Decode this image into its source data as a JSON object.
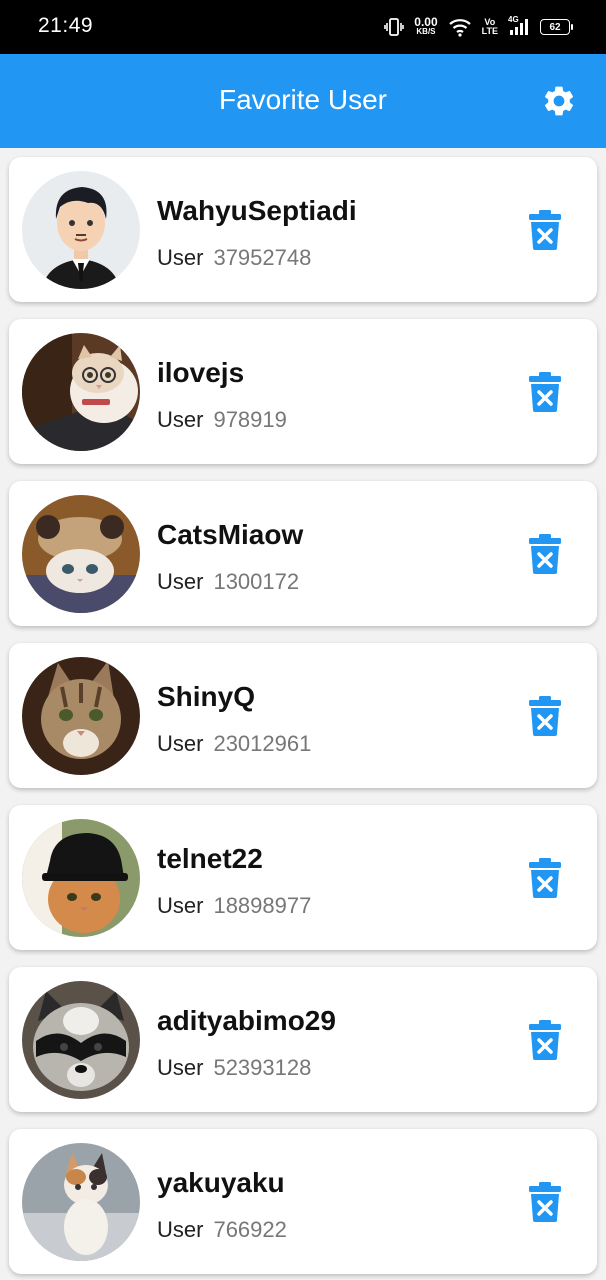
{
  "status_bar": {
    "time": "21:49",
    "net_speed_value": "0.00",
    "net_speed_unit": "KB/S",
    "volte_top": "Vo",
    "volte_bottom": "LTE",
    "network": "4G",
    "battery": "62"
  },
  "app_bar": {
    "title": "Favorite User",
    "settings_icon": "gear-icon"
  },
  "colors": {
    "primary": "#2196f3",
    "delete_icon": "#2196f3"
  },
  "users": [
    {
      "name": "WahyuSeptiadi",
      "type": "User",
      "id": "37952748",
      "avatar": "cartoon-man-avatar"
    },
    {
      "name": "ilovejs",
      "type": "User",
      "id": "978919",
      "avatar": "cat-with-glasses-avatar"
    },
    {
      "name": "CatsMiaow",
      "type": "User",
      "id": "1300172",
      "avatar": "cat-with-hat-avatar"
    },
    {
      "name": "ShinyQ",
      "type": "User",
      "id": "23012961",
      "avatar": "tabby-cat-avatar"
    },
    {
      "name": "telnet22",
      "type": "User",
      "id": "18898977",
      "avatar": "security-cap-cat-avatar"
    },
    {
      "name": "adityabimo29",
      "type": "User",
      "id": "52393128",
      "avatar": "raccoon-avatar"
    },
    {
      "name": "yakuyaku",
      "type": "User",
      "id": "766922",
      "avatar": "kitten-avatar"
    }
  ]
}
